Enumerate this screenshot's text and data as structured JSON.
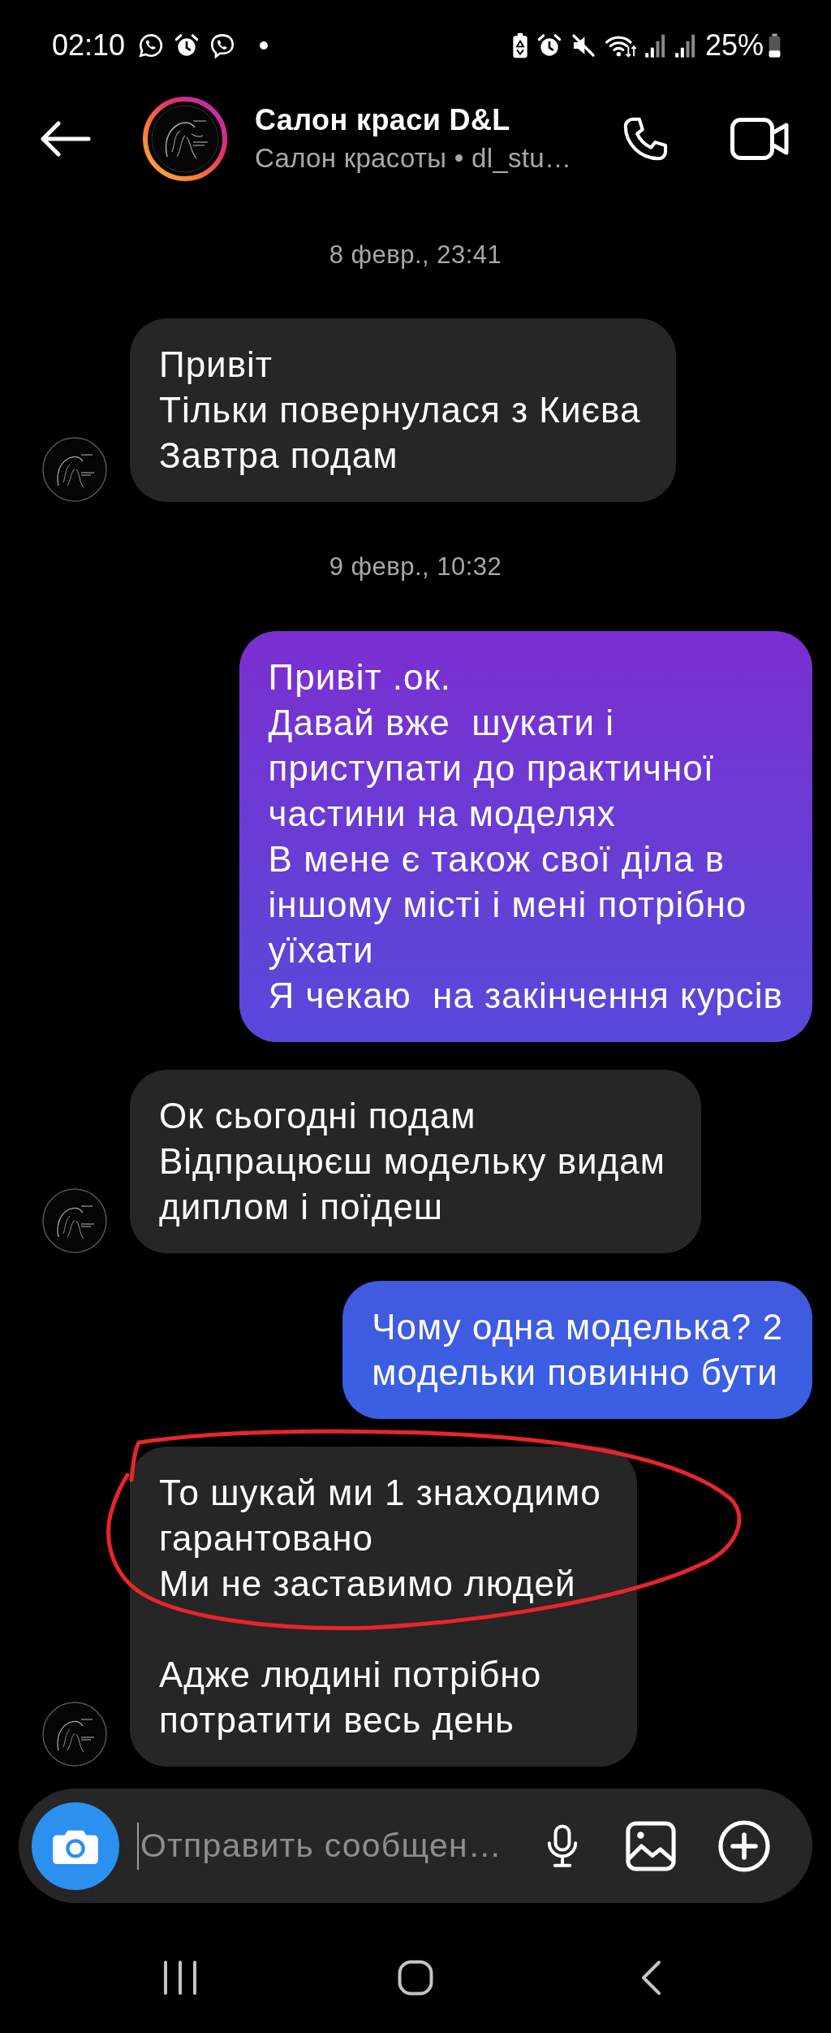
{
  "status_bar": {
    "time": "02:10",
    "battery": "25%"
  },
  "header": {
    "avatar": {
      "story_ring": true
    },
    "title": "Салон краси D&L",
    "subtitle": "Салон красоты • dl_stu…"
  },
  "messages": [
    {
      "kind": "date",
      "text": "8 февр., 23:41"
    },
    {
      "kind": "received",
      "show_avatar": true,
      "circled": false,
      "text": "Привіт\nТільки повернулася з Києва\nЗавтра подам"
    },
    {
      "kind": "date",
      "text": "9 февр., 10:32"
    },
    {
      "kind": "sent",
      "text": "Привіт .ок.\nДавай вже  шукати і\nприступати до практичної\nчастини на моделях\nВ мене є також свої діла в\nіншому місті і мені потрібно\nуїхати\nЯ чекаю  на закінчення курсів"
    },
    {
      "kind": "received",
      "show_avatar": true,
      "circled": false,
      "text": "Ок сьогодні подам\nВідпрацюєш модельку видам\nдиплом і поїдеш"
    },
    {
      "kind": "sent",
      "text": "Чому одна моделька? 2\nмодельки повинно бути"
    },
    {
      "kind": "received",
      "show_avatar": true,
      "circled": true,
      "text": "То шукай ми 1 знаходимо\nгарантовано\nМи не заставимо людей\n\nАдже людині потрібно\nпотратити весь день"
    }
  ],
  "composer": {
    "placeholder": "Отправить сообщен…",
    "focused": true
  }
}
